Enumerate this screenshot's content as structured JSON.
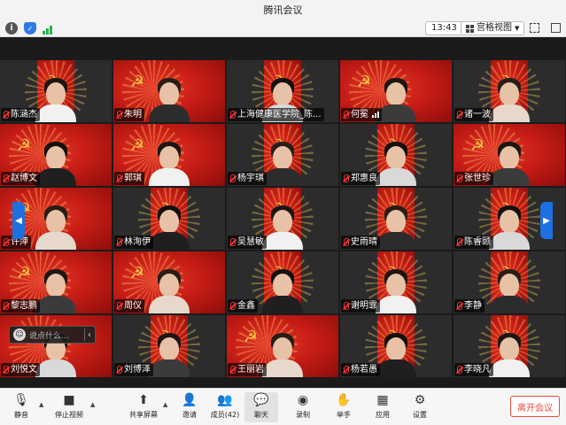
{
  "window": {
    "title": "腾讯会议"
  },
  "topbar": {
    "time": "13:43",
    "view_label": "宫格视图"
  },
  "colors": {
    "accent": "#1e6fe0",
    "leave": "#e84c3d",
    "background_red": "#c71d16"
  },
  "participants": [
    {
      "name": "陈涵杰"
    },
    {
      "name": "朱明"
    },
    {
      "name": "上海健康医学院_陈..."
    },
    {
      "name": "何冕"
    },
    {
      "name": "诸一波"
    },
    {
      "name": "赵博文"
    },
    {
      "name": "郭琪"
    },
    {
      "name": "杨宇琪"
    },
    {
      "name": "郑惠良"
    },
    {
      "name": "张世珍"
    },
    {
      "name": "许萍"
    },
    {
      "name": "林洵伊"
    },
    {
      "name": "吴慧敏"
    },
    {
      "name": "史雨晴"
    },
    {
      "name": "陈睿颐"
    },
    {
      "name": "黎志鹏"
    },
    {
      "name": "周仪"
    },
    {
      "name": "金鑫"
    },
    {
      "name": "谢明霏"
    },
    {
      "name": "李静"
    },
    {
      "name": "刘悦文"
    },
    {
      "name": "刘博泽"
    },
    {
      "name": "王丽岩"
    },
    {
      "name": "杨若愚"
    },
    {
      "name": "李晓凡"
    }
  ],
  "chat": {
    "placeholder": "说点什么..."
  },
  "toolbar": {
    "mute": "静音",
    "stop_video": "停止视频",
    "share_screen": "共享屏幕",
    "invite": "邀请",
    "members": "成员(42)",
    "chat": "聊天",
    "record": "录制",
    "raise_hand": "举手",
    "apps": "应用",
    "settings": "设置",
    "leave": "离开会议"
  }
}
